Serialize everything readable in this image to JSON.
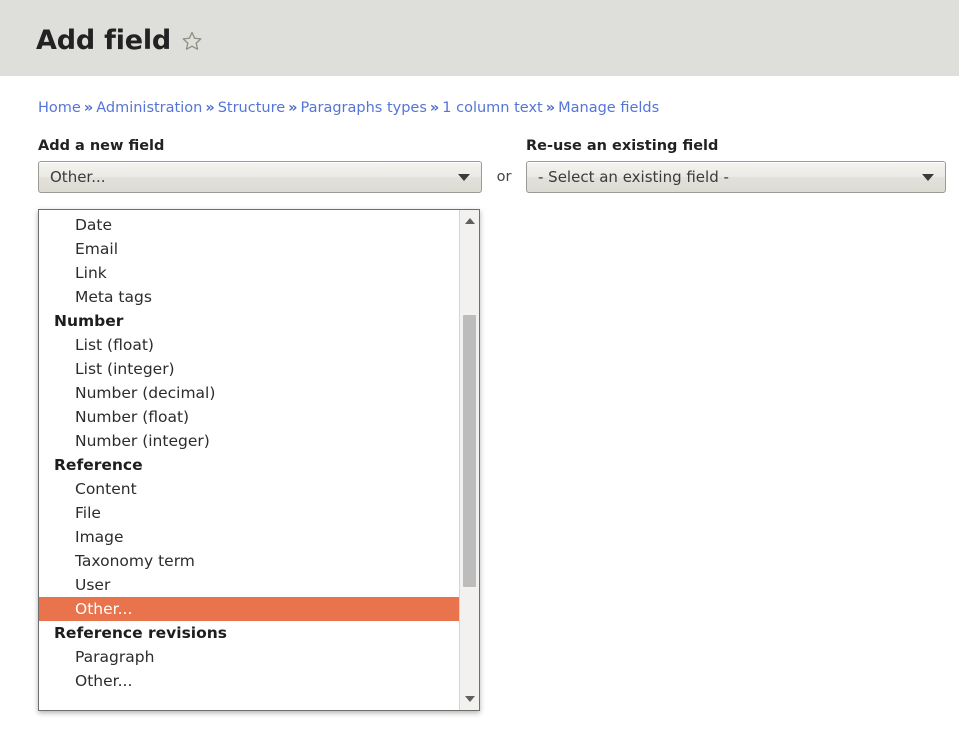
{
  "header": {
    "title": "Add field",
    "star_icon": "star-outline-icon"
  },
  "breadcrumb": {
    "separator": "»",
    "items": [
      "Home",
      "Administration",
      "Structure",
      "Paragraphs types",
      "1 column text",
      "Manage fields"
    ]
  },
  "form": {
    "new_field": {
      "label": "Add a new field",
      "selected_value": "Other..."
    },
    "or_label": "or",
    "existing_field": {
      "label": "Re-use an existing field",
      "selected_value": "- Select an existing field -"
    }
  },
  "dropdown": {
    "open": true,
    "highlight_color": "#e8734c",
    "selected_index": 16,
    "options": [
      {
        "label": "Date",
        "group": false
      },
      {
        "label": "Email",
        "group": false
      },
      {
        "label": "Link",
        "group": false
      },
      {
        "label": "Meta tags",
        "group": false
      },
      {
        "label": "Number",
        "group": true
      },
      {
        "label": "List (float)",
        "group": false
      },
      {
        "label": "List (integer)",
        "group": false
      },
      {
        "label": "Number (decimal)",
        "group": false
      },
      {
        "label": "Number (float)",
        "group": false
      },
      {
        "label": "Number (integer)",
        "group": false
      },
      {
        "label": "Reference",
        "group": true
      },
      {
        "label": "Content",
        "group": false
      },
      {
        "label": "File",
        "group": false
      },
      {
        "label": "Image",
        "group": false
      },
      {
        "label": "Taxonomy term",
        "group": false
      },
      {
        "label": "User",
        "group": false
      },
      {
        "label": "Other...",
        "group": false,
        "selected": true
      },
      {
        "label": "Reference revisions",
        "group": true
      },
      {
        "label": "Paragraph",
        "group": false
      },
      {
        "label": "Other...",
        "group": false
      }
    ],
    "scrollbar": {
      "up_arrow": "triangle-up-icon",
      "down_arrow": "triangle-down-icon"
    }
  }
}
